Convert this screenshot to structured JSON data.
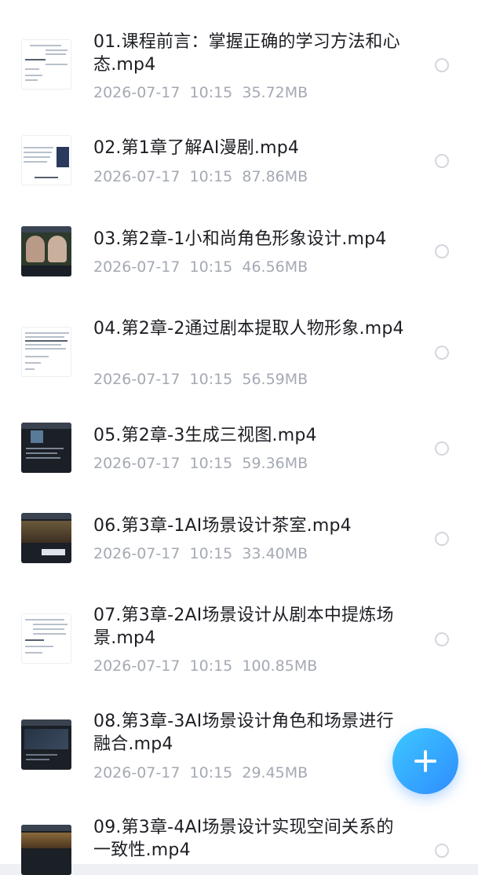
{
  "files": [
    {
      "title": "01.课程前言：掌握正确的学习方法和心态.mp4",
      "date": "2026-07-17",
      "time": "10:15",
      "size": "35.72MB",
      "thumb": "doc-text"
    },
    {
      "title": "02.第1章了解AI漫剧.mp4",
      "date": "2026-07-17",
      "time": "10:15",
      "size": "87.86MB",
      "thumb": "doc-image"
    },
    {
      "title": "03.第2章-1小和尚角色形象设计.mp4",
      "date": "2026-07-17",
      "time": "10:15",
      "size": "46.56MB",
      "thumb": "video-characters"
    },
    {
      "title": "04.第2章-2通过剧本提取人物形象.mp4",
      "date": "2026-07-17",
      "time": "10:15",
      "size": "56.59MB",
      "thumb": "doc-text"
    },
    {
      "title": "05.第2章-3生成三视图.mp4",
      "date": "2026-07-17",
      "time": "10:15",
      "size": "59.36MB",
      "thumb": "video-dark-ui"
    },
    {
      "title": "06.第3章-1AI场景设计茶室.mp4",
      "date": "2026-07-17",
      "time": "10:15",
      "size": "33.40MB",
      "thumb": "video-scene"
    },
    {
      "title": "07.第3章-2AI场景设计从剧本中提炼场景.mp4",
      "date": "2026-07-17",
      "time": "10:15",
      "size": "100.85MB",
      "thumb": "doc-text"
    },
    {
      "title": "08.第3章-3AI场景设计角色和场景进行融合.mp4",
      "date": "2026-07-17",
      "time": "10:15",
      "size": "29.45MB",
      "thumb": "video-dark-ui"
    },
    {
      "title": "09.第3章-4AI场景设计实现空间关系的一致性.mp4",
      "date": "",
      "time": "",
      "size": "",
      "thumb": "video-scene"
    }
  ],
  "fab": {
    "icon": "plus-icon"
  },
  "colors": {
    "accent": "#2f8cff",
    "accent_light": "#3dc8ff",
    "title_text": "#1c1e23",
    "meta_text": "#a4a9b3"
  }
}
